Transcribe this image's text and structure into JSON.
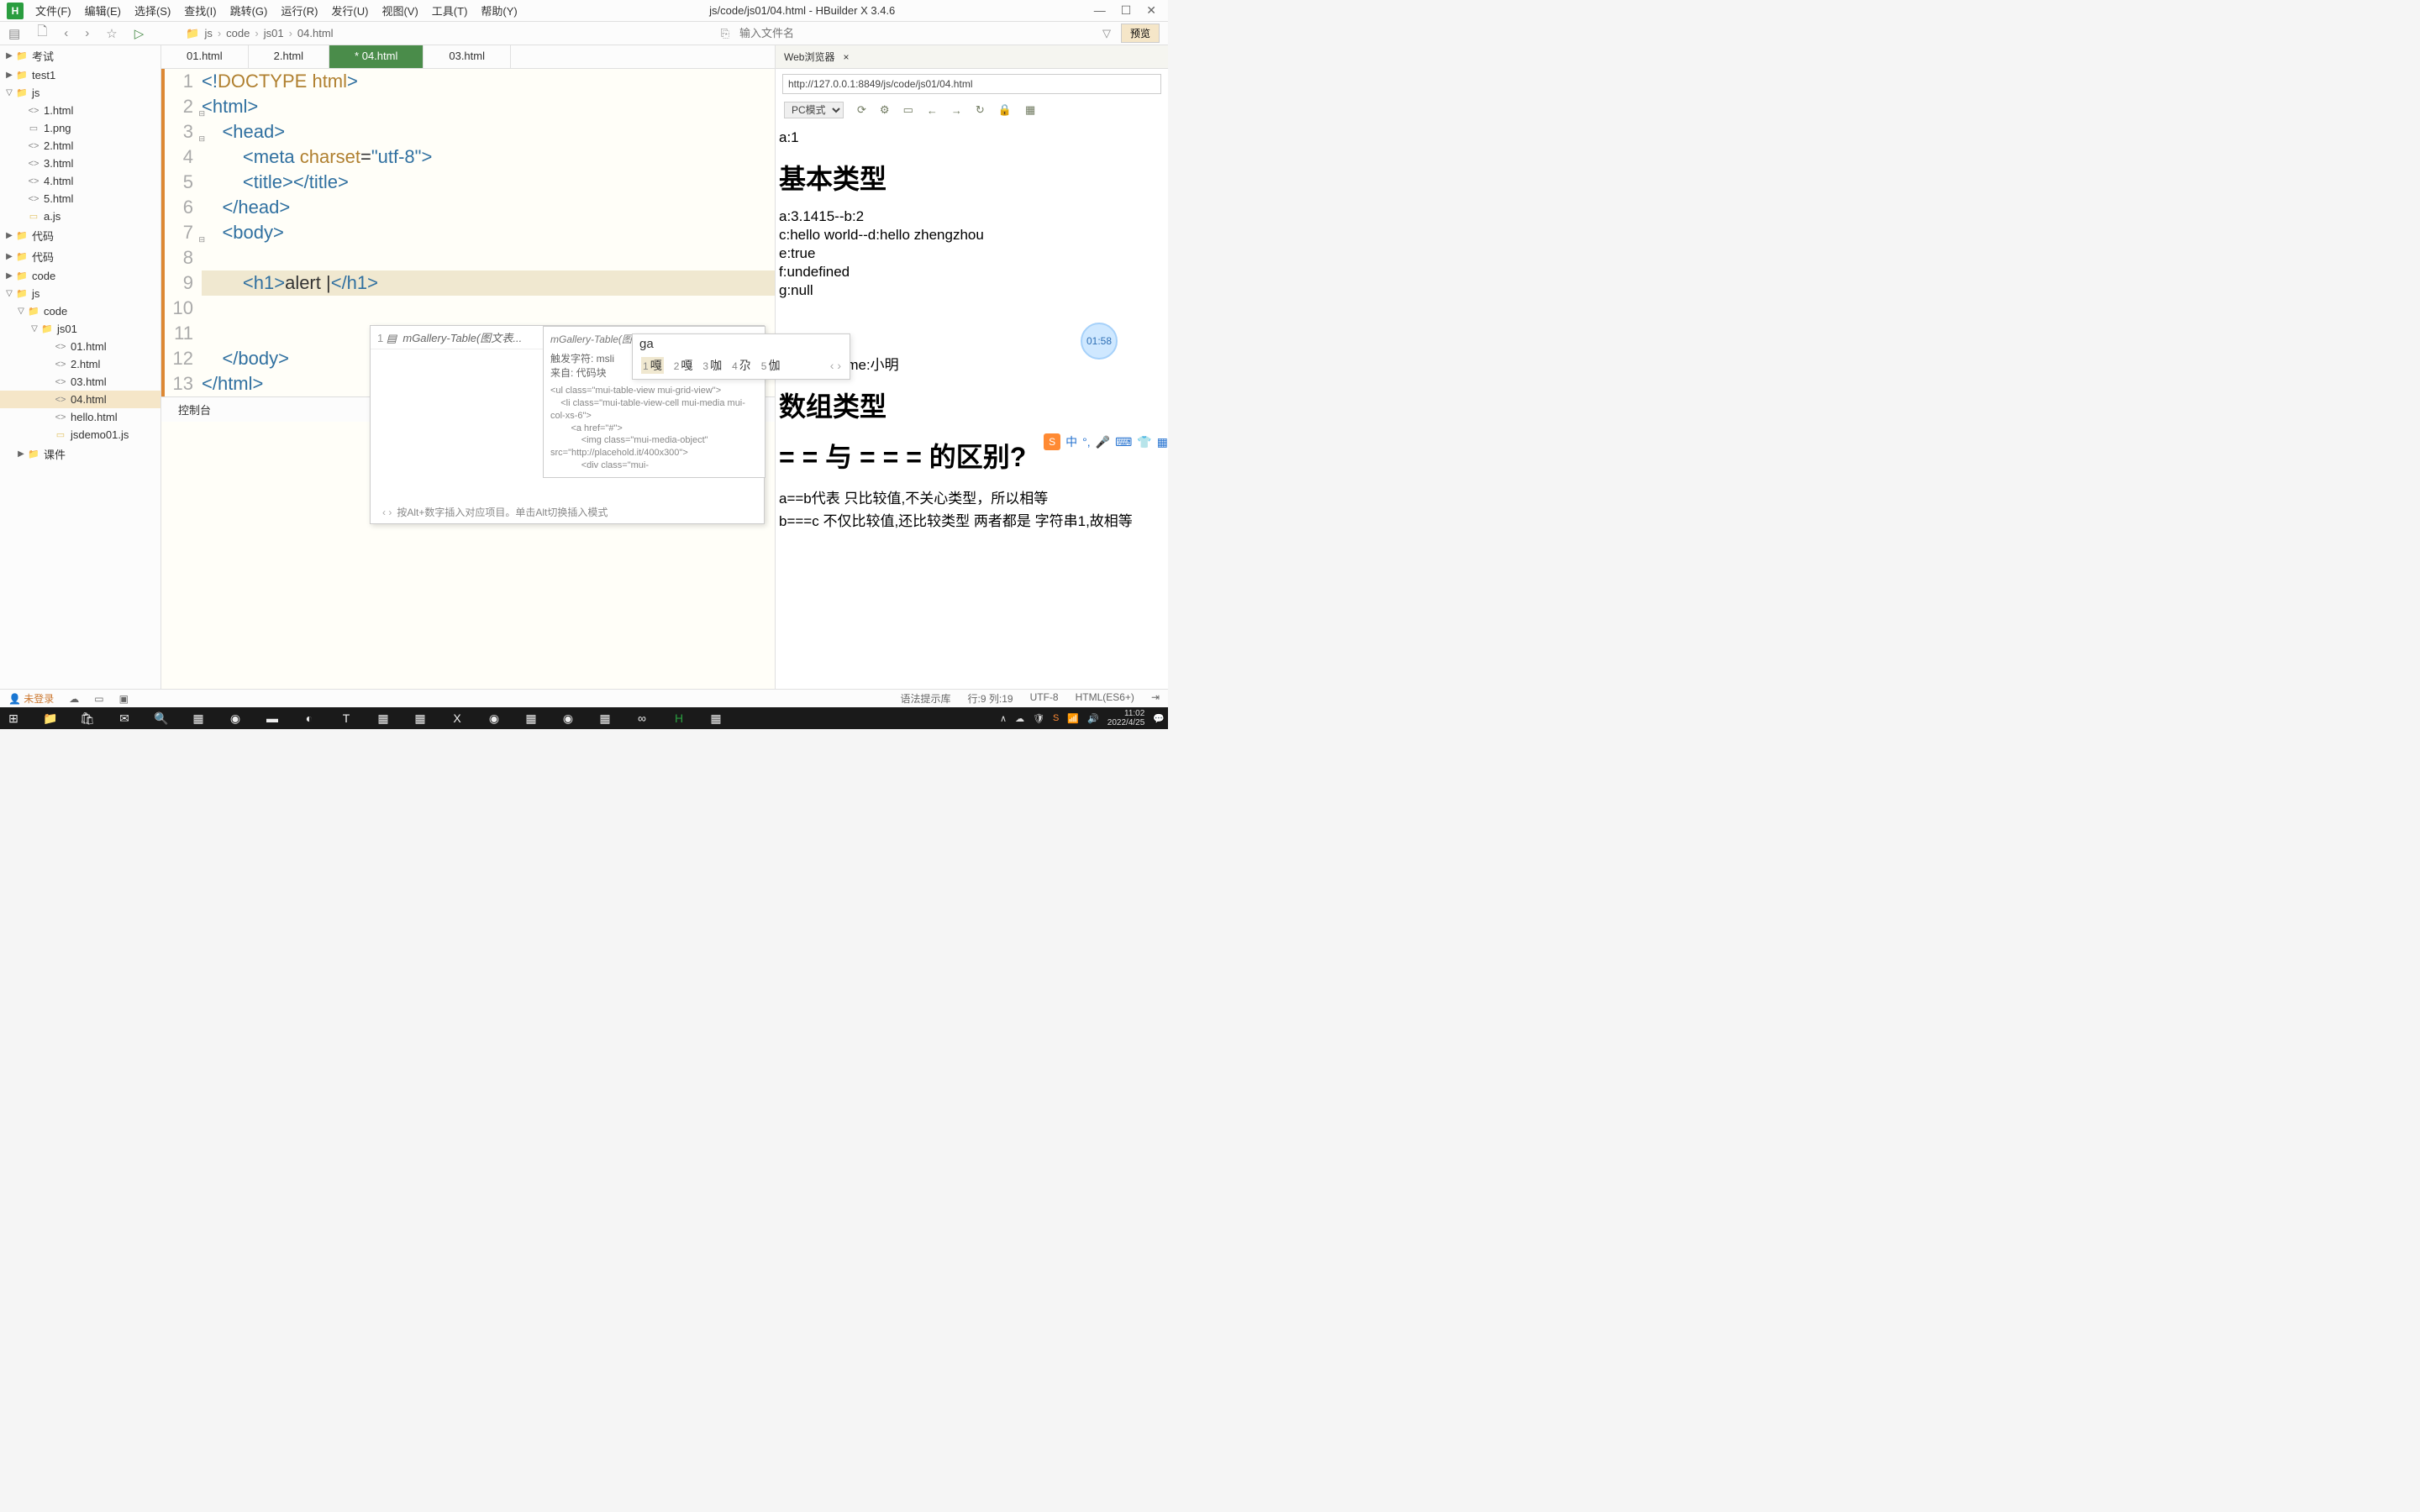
{
  "titlebar": {
    "logo": "H",
    "menus": [
      "文件(F)",
      "编辑(E)",
      "选择(S)",
      "查找(I)",
      "跳转(G)",
      "运行(R)",
      "发行(U)",
      "视图(V)",
      "工具(T)",
      "帮助(Y)"
    ],
    "title": "js/code/js01/04.html - HBuilder X 3.4.6"
  },
  "toolbar": {
    "breadcrumb": [
      "js",
      "code",
      "js01",
      "04.html"
    ],
    "search_placeholder": "输入文件名",
    "preview": "预览"
  },
  "sidebar": {
    "items": [
      {
        "type": "folder-closed",
        "label": "考试",
        "pad": 0,
        "arrow": "▶"
      },
      {
        "type": "folder-closed",
        "label": "test1",
        "pad": 0,
        "arrow": "▶"
      },
      {
        "type": "folder-open",
        "label": "js",
        "pad": 0,
        "arrow": "▽"
      },
      {
        "type": "file-html",
        "label": "1.html",
        "pad": 1,
        "prefix": "<>"
      },
      {
        "type": "file-png",
        "label": "1.png",
        "pad": 1,
        "prefix": "▭"
      },
      {
        "type": "file-html",
        "label": "2.html",
        "pad": 1,
        "prefix": "<>"
      },
      {
        "type": "file-html",
        "label": "3.html",
        "pad": 1,
        "prefix": "<>"
      },
      {
        "type": "file-html",
        "label": "4.html",
        "pad": 1,
        "prefix": "<>"
      },
      {
        "type": "file-html",
        "label": "5.html",
        "pad": 1,
        "prefix": "<>"
      },
      {
        "type": "file-js",
        "label": "a.js",
        "pad": 1,
        "prefix": "▭"
      },
      {
        "type": "folder-closed",
        "label": "代码",
        "pad": 0,
        "arrow": "▶"
      },
      {
        "type": "folder-closed",
        "label": "代码",
        "pad": 0,
        "arrow": "▶"
      },
      {
        "type": "folder-closed",
        "label": "code",
        "pad": 0,
        "arrow": "▶"
      },
      {
        "type": "folder-open",
        "label": "js",
        "pad": 0,
        "arrow": "▽"
      },
      {
        "type": "folder-open",
        "label": "code",
        "pad": 1,
        "arrow": "▽"
      },
      {
        "type": "folder-open",
        "label": "js01",
        "pad": 2,
        "arrow": "▽"
      },
      {
        "type": "file-html",
        "label": "01.html",
        "pad": 3,
        "prefix": "<>"
      },
      {
        "type": "file-html",
        "label": "2.html",
        "pad": 3,
        "prefix": "<>"
      },
      {
        "type": "file-html",
        "label": "03.html",
        "pad": 3,
        "prefix": "<>"
      },
      {
        "type": "file-html",
        "label": "04.html",
        "pad": 3,
        "prefix": "<>",
        "active": true
      },
      {
        "type": "file-html",
        "label": "hello.html",
        "pad": 3,
        "prefix": "<>"
      },
      {
        "type": "file-js",
        "label": "jsdemo01.js",
        "pad": 3,
        "prefix": "▭"
      },
      {
        "type": "folder-closed",
        "label": "课件",
        "pad": 1,
        "arrow": "▶"
      }
    ]
  },
  "tabs": [
    "01.html",
    "2.html",
    "* 04.html",
    "03.html"
  ],
  "active_tab": 2,
  "code": {
    "lines": [
      {
        "n": 1,
        "html": "<span class='tok-tag'>&lt;!</span><span class='tok-doc'>DOCTYPE</span> <span class='tok-doc'>html</span><span class='tok-tag'>&gt;</span>"
      },
      {
        "n": 2,
        "html": "<span class='tok-tag'>&lt;html&gt;</span>",
        "fold": "⊟"
      },
      {
        "n": 3,
        "html": "    <span class='tok-tag'>&lt;head&gt;</span>",
        "fold": "⊟"
      },
      {
        "n": 4,
        "html": "        <span class='tok-tag'>&lt;meta</span> <span class='tok-attr'>charset</span>=<span class='tok-str'>\"utf-8\"</span><span class='tok-tag'>&gt;</span>"
      },
      {
        "n": 5,
        "html": "        <span class='tok-tag'>&lt;title&gt;&lt;/title&gt;</span>"
      },
      {
        "n": 6,
        "html": "    <span class='tok-tag'>&lt;/head&gt;</span>"
      },
      {
        "n": 7,
        "html": "    <span class='tok-tag'>&lt;body&gt;</span>",
        "fold": "⊟"
      },
      {
        "n": 8,
        "html": ""
      },
      {
        "n": 9,
        "html": "        <span class='tok-tag'>&lt;h1&gt;</span><span class='tok-text'>alert </span>|<span class='tok-tag'>&lt;/h1&gt;</span>",
        "hl": true
      },
      {
        "n": 10,
        "html": ""
      },
      {
        "n": 11,
        "html": ""
      },
      {
        "n": 12,
        "html": "    <span class='tok-tag'>&lt;/body&gt;</span>"
      },
      {
        "n": 13,
        "html": "<span class='tok-tag'>&lt;/html&gt;</span>"
      }
    ]
  },
  "autocomplete": {
    "row_num": "1",
    "row_label": "mGallery-Table(图文表...",
    "detail_title": "mGallery-Table(图文表格)",
    "detail_trigger": "触发字符: msli",
    "detail_source": "来自: 代码块",
    "detail_code": "<ul class=\"mui-table-view mui-grid-view\">\n    <li class=\"mui-table-view-cell mui-media mui-col-xs-6\">\n        <a href=\"#\">\n            <img class=\"mui-media-object\" src=\"http://placehold.it/400x300\">\n            <div class=\"mui-",
    "hint": "按Alt+数字插入对应项目。单击Alt切换插入模式"
  },
  "ime": {
    "input": "ga",
    "candidates": [
      {
        "n": "1",
        "t": "嘎"
      },
      {
        "n": "2",
        "t": "嘎"
      },
      {
        "n": "3",
        "t": "咖"
      },
      {
        "n": "4",
        "t": "尕"
      },
      {
        "n": "5",
        "t": "伽"
      }
    ]
  },
  "browser": {
    "tab": "Web浏览器",
    "url": "http://127.0.0.1:8849/js/code/js01/04.html",
    "mode": "PC模式",
    "content": {
      "l1": "a:1",
      "h1": "基本类型",
      "l2": "a:3.1415--b:2",
      "l3": "c:hello world--d:hello zhengzhou",
      "l4": "e:true",
      "l5": "f:undefined",
      "l6": "g:null",
      "l7": "student-name:小明",
      "h2": "数组类型",
      "h3": "= = 与 = = = 的区别?",
      "l8": "a==b代表 只比较值,不关心类型，所以相等",
      "l9": "b===c 不仅比较值,还比较类型 两者都是 字符串1,故相等"
    },
    "timer": "01:58"
  },
  "console": {
    "tab": "控制台"
  },
  "statusbar": {
    "user": "未登录",
    "hint_lib": "语法提示库",
    "cursor": "行:9  列:19",
    "encoding": "UTF-8",
    "lang": "HTML(ES6+)"
  },
  "taskbar": {
    "time": "11:02",
    "date": "2022/4/25"
  }
}
